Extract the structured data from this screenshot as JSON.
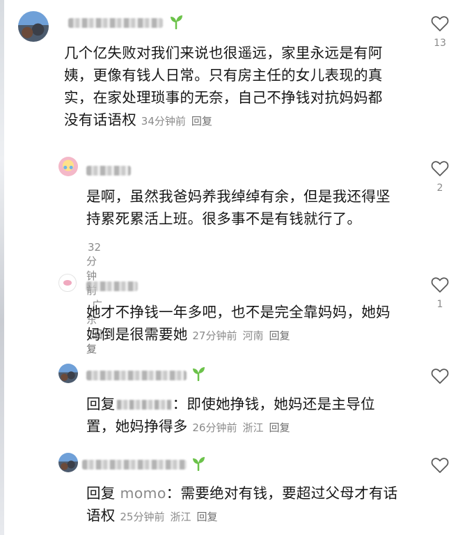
{
  "comments": [
    {
      "text_lines": [
        "几个亿失败对我们来说也很遥远，家里永远是有阿",
        "姨，更像有钱人日常。只有房主任的女儿表现的真",
        "实，在家处理琐事的无奈，自己不挣钱对抗妈妈都",
        "没有话语权"
      ],
      "time": "34分钟前",
      "location": "",
      "reply_label": "回复",
      "likes": "13",
      "avatar_icon": "city-photo-avatar",
      "badge_icon": "sprout-icon"
    },
    {
      "text_lines": [
        "是啊，虽然我爸妈养我绰绰有余，但是我还得坚",
        "持累死累活上班。很多事不是有钱就行了。"
      ],
      "time": "32分钟前",
      "location": "广东",
      "reply_label": "回复",
      "likes": "2",
      "avatar_icon": "anime-avatar"
    },
    {
      "text_lines": [
        "她才不挣钱一年多吧，也不是完全靠妈妈，她妈",
        "妈倒是很需要她"
      ],
      "time": "27分钟前",
      "location": "河南",
      "reply_label": "回复",
      "likes": "1",
      "avatar_icon": "pig-avatar"
    },
    {
      "reply_prefix": "回复",
      "text_first": "：即使她挣钱，她妈还是主导位",
      "text_lines": [
        "置，她妈挣得多"
      ],
      "time": "26分钟前",
      "location": "浙江",
      "reply_label": "回复",
      "likes": "",
      "avatar_icon": "city-photo-avatar",
      "badge_icon": "sprout-icon"
    },
    {
      "reply_prefix": "回复",
      "reply_to": "momo",
      "text_first": "：需要绝对有钱，要超过父母才有话",
      "text_lines": [
        "语权"
      ],
      "time": "25分钟前",
      "location": "浙江",
      "reply_label": "回复",
      "likes": "",
      "avatar_icon": "city-photo-avatar",
      "badge_icon": "sprout-icon"
    }
  ],
  "colors": {
    "text": "#161616",
    "meta": "#8a8a8a",
    "sprout": "#6cc24a"
  }
}
